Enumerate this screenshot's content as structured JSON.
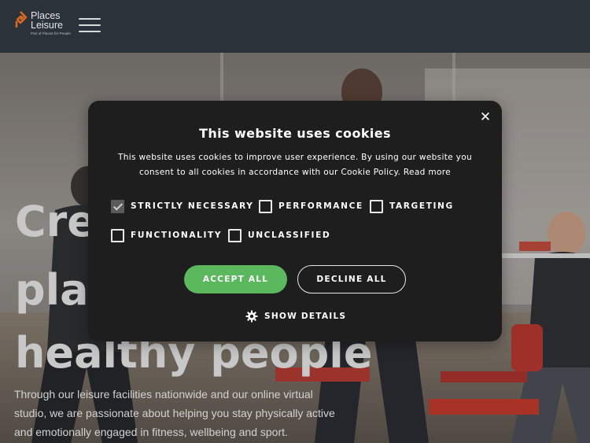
{
  "header": {
    "logo_line1": "Places",
    "logo_line2": "Leisure",
    "logo_tagline": "Part of Places for People",
    "menu_icon": "hamburger-menu-icon"
  },
  "hero": {
    "title_lines": [
      "Crea",
      "plac",
      "healthy people"
    ],
    "text_lines": [
      "Through our leisure facilities nationwide and our online virtual",
      "studio, we are passionate about helping you stay physically active",
      "and emotionally engaged in fitness, wellbeing and sport."
    ]
  },
  "cookie_modal": {
    "close_icon": "close-icon",
    "title": "This website uses cookies",
    "description": "This website uses cookies to improve user experience. By using our website you consent to all cookies in accordance with our Cookie Policy.",
    "read_more": "Read more",
    "options": [
      {
        "label": "STRICTLY NECESSARY",
        "checked": true
      },
      {
        "label": "PERFORMANCE",
        "checked": false
      },
      {
        "label": "TARGETING",
        "checked": false
      },
      {
        "label": "FUNCTIONALITY",
        "checked": false
      },
      {
        "label": "UNCLASSIFIED",
        "checked": false
      }
    ],
    "accept_label": "ACCEPT ALL",
    "decline_label": "DECLINE ALL",
    "details_icon": "gear-icon",
    "details_label": "SHOW DETAILS"
  },
  "colors": {
    "topbar": "#2c323a",
    "modal_bg": "#1e1e1e",
    "accept_green": "#5cb85c",
    "logo_orange": "#d9691f"
  }
}
